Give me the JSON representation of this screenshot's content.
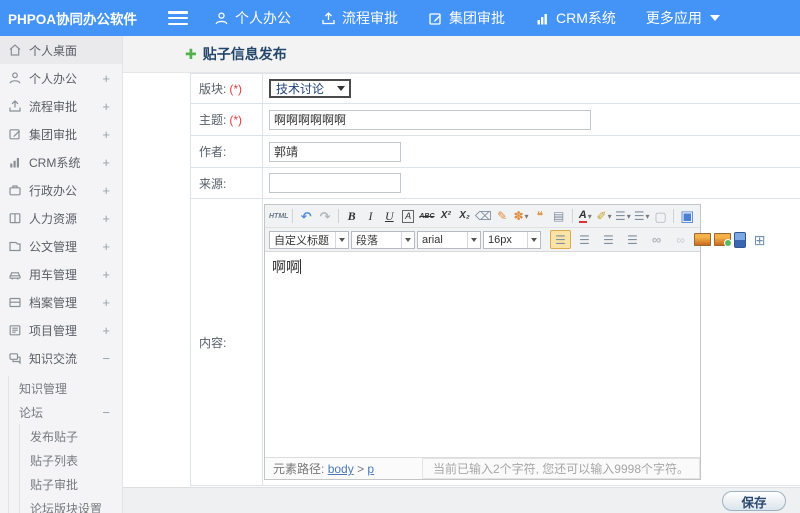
{
  "topbar": {
    "logo": "PHPOA协同办公软件",
    "nav": [
      {
        "label": "个人办公"
      },
      {
        "label": "流程审批"
      },
      {
        "label": "集团审批"
      },
      {
        "label": "CRM系统"
      },
      {
        "label": "更多应用"
      }
    ]
  },
  "sidebar": {
    "items": [
      {
        "label": "个人桌面",
        "expand": ""
      },
      {
        "label": "个人办公",
        "expand": "+"
      },
      {
        "label": "流程审批",
        "expand": "+"
      },
      {
        "label": "集团审批",
        "expand": "+"
      },
      {
        "label": "CRM系统",
        "expand": "+"
      },
      {
        "label": "行政办公",
        "expand": "+"
      },
      {
        "label": "人力资源",
        "expand": "+"
      },
      {
        "label": "公文管理",
        "expand": "+"
      },
      {
        "label": "用车管理",
        "expand": "+"
      },
      {
        "label": "档案管理",
        "expand": "+"
      },
      {
        "label": "项目管理",
        "expand": "+"
      },
      {
        "label": "知识交流",
        "expand": "−"
      },
      {
        "label": "知识管理",
        "expand": ""
      },
      {
        "label": "论坛",
        "expand": "−"
      },
      {
        "label": "发布贴子",
        "expand": ""
      },
      {
        "label": "贴子列表",
        "expand": ""
      },
      {
        "label": "贴子审批",
        "expand": ""
      },
      {
        "label": "论坛版块设置",
        "expand": ""
      }
    ]
  },
  "page": {
    "title": "贴子信息发布"
  },
  "form": {
    "section_label": "版块:",
    "section_required": "(*)",
    "section_value": "技术讨论",
    "subject_label": "主题:",
    "subject_required": "(*)",
    "subject_value": "啊啊啊啊啊啊",
    "author_label": "作者:",
    "author_value": "郭靖",
    "source_label": "来源:",
    "source_value": "",
    "content_label": "内容:",
    "save_label": "保存"
  },
  "editor": {
    "toolbar1": [
      {
        "name": "html-source-icon",
        "glyph": "HTML",
        "cls": "t-html"
      },
      {
        "name": "separator",
        "cls": "sep"
      },
      {
        "name": "undo-icon",
        "glyph": "↶",
        "cls": "c-blue"
      },
      {
        "name": "redo-icon",
        "glyph": "↷",
        "cls": "c-gray"
      },
      {
        "name": "separator",
        "cls": "sep"
      },
      {
        "name": "bold-icon",
        "glyph": "B",
        "cls": "t-bold"
      },
      {
        "name": "italic-icon",
        "glyph": "I",
        "cls": "t-italic"
      },
      {
        "name": "underline-icon",
        "glyph": "U",
        "cls": "t-underline"
      },
      {
        "name": "font-box-icon",
        "glyph": "A",
        "cls": "t-box"
      },
      {
        "name": "strikethrough-icon",
        "glyph": "ABC",
        "cls": "t-strike"
      },
      {
        "name": "superscript-icon",
        "glyph": "X²",
        "cls": "t-small"
      },
      {
        "name": "subscript-icon",
        "glyph": "X₂",
        "cls": "t-small"
      },
      {
        "name": "eraser-icon",
        "glyph": "⌫",
        "cls": "c-steel"
      },
      {
        "name": "format-brush-icon",
        "glyph": "✎",
        "cls": "c-orange"
      },
      {
        "name": "spray-color-icon",
        "glyph": "✽",
        "cls": "c-orange caret"
      },
      {
        "name": "blockquote-icon",
        "glyph": "❝",
        "cls": "c-orange"
      },
      {
        "name": "paste-plain-icon",
        "glyph": "▤",
        "cls": "c-steel"
      },
      {
        "name": "separator",
        "cls": "sep"
      },
      {
        "name": "font-color-icon",
        "glyph": "A",
        "cls": "t-fontcolor caret"
      },
      {
        "name": "highlight-pen-icon",
        "glyph": "✐",
        "cls": "c-gold caret"
      },
      {
        "name": "ordered-list-icon",
        "glyph": "☰",
        "cls": "c-steel caret"
      },
      {
        "name": "unordered-list-icon",
        "glyph": "☰",
        "cls": "c-steel caret"
      },
      {
        "name": "new-doc-icon",
        "glyph": "▢",
        "cls": "c-gray"
      },
      {
        "name": "separator",
        "cls": "sep"
      },
      {
        "name": "fullscreen-icon",
        "glyph": "▣",
        "cls": "c-blue-big"
      }
    ],
    "dropdowns": [
      {
        "name": "heading-select",
        "label": "自定义标题",
        "cls": "w1"
      },
      {
        "name": "paragraph-select",
        "label": "段落",
        "cls": "w2"
      },
      {
        "name": "font-family-select",
        "label": "arial",
        "cls": "w3"
      },
      {
        "name": "font-size-select",
        "label": "16px",
        "cls": "w4"
      }
    ],
    "toolbar2": [
      {
        "name": "align-left-icon",
        "glyph": "☰",
        "cls": "c-steel active"
      },
      {
        "name": "align-center-icon",
        "glyph": "☰",
        "cls": "c-steel"
      },
      {
        "name": "align-right-icon",
        "glyph": "☰",
        "cls": "c-steel"
      },
      {
        "name": "align-justify-icon",
        "glyph": "☰",
        "cls": "c-steel"
      },
      {
        "name": "link-icon",
        "glyph": "∞",
        "cls": "c-gray"
      },
      {
        "name": "unlink-icon",
        "glyph": "∞",
        "cls": "c-faint"
      },
      {
        "name": "image-icon",
        "cls": "img-icon"
      },
      {
        "name": "picture-icon",
        "cls": "img-icon img2"
      },
      {
        "name": "media-icon",
        "cls": "media-icon"
      },
      {
        "name": "table-icon",
        "glyph": "⊞",
        "cls": "c-steel-big"
      }
    ],
    "content_text": "啊啊",
    "path_label": "元素路径:",
    "path_link1": "body",
    "path_sep": ">",
    "path_link2": "p",
    "char_info": "当前已输入2个字符, 您还可以输入9998个字符。"
  },
  "colors": {
    "topbar_blue": "#4493f7",
    "title_navy": "#24466b",
    "required_red": "#e43d3d",
    "plus_green": "#55b14e"
  }
}
